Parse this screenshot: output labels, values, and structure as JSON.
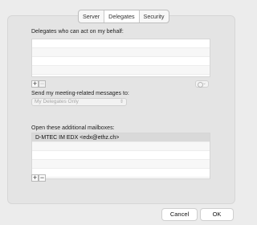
{
  "tabs": [
    {
      "label": "Server",
      "active": false
    },
    {
      "label": "Delegates",
      "active": true
    },
    {
      "label": "Security",
      "active": false
    }
  ],
  "delegates": {
    "heading": "Delegates who can act on my behalf:",
    "rows": [
      "",
      "",
      "",
      ""
    ],
    "add_icon": "plus-icon",
    "remove_icon": "minus-icon",
    "action_icon": "gear-icon"
  },
  "meeting_messages": {
    "label": "Send my meeting-related messages to:",
    "selected": "My Delegates Only"
  },
  "mailboxes": {
    "heading": "Open these additional mailboxes:",
    "rows": [
      "D-MTEC IM EDX <edx@ethz.ch>",
      "",
      "",
      "",
      ""
    ],
    "add_icon": "plus-icon",
    "remove_icon": "minus-icon"
  },
  "footer": {
    "cancel_label": "Cancel",
    "ok_label": "OK"
  }
}
